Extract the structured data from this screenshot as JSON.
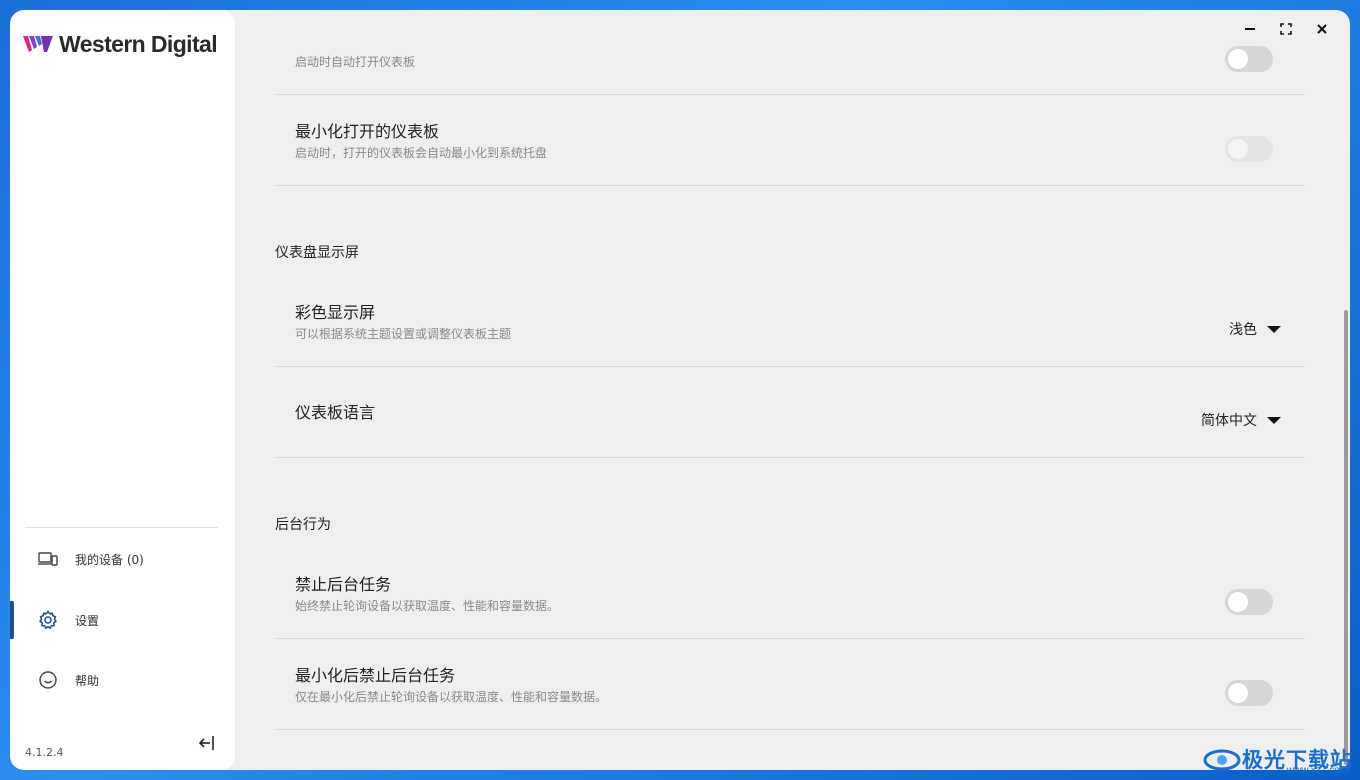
{
  "app": {
    "brand": "Western Digital",
    "version": "4.1.2.4",
    "accent": "#1f4e8c"
  },
  "window_controls": {
    "minimize": "minimize-icon",
    "maximize": "maximize-icon",
    "close": "close-icon"
  },
  "sidebar": {
    "items": [
      {
        "label": "我的设备 (0)",
        "icon": "devices-icon",
        "active": false
      },
      {
        "label": "设置",
        "icon": "gear-icon",
        "active": true
      },
      {
        "label": "帮助",
        "icon": "smile-icon",
        "active": false
      }
    ],
    "collapse_icon": "collapse-left-icon"
  },
  "settings": {
    "startup_row": {
      "subtitle": "启动时自动打开仪表板",
      "toggle_on": false
    },
    "minimize_row": {
      "title": "最小化打开的仪表板",
      "subtitle": "启动时，打开的仪表板会自动最小化到系统托盘",
      "toggle_on": false,
      "disabled": true
    },
    "display_section": "仪表盘显示屏",
    "color_row": {
      "title": "彩色显示屏",
      "subtitle": "可以根据系统主题设置或调整仪表板主题",
      "value": "浅色"
    },
    "language_row": {
      "title": "仪表板语言",
      "value": "简体中文"
    },
    "background_section": "后台行为",
    "disable_bg_row": {
      "title": "禁止后台任务",
      "subtitle": "始终禁止轮询设备以获取温度、性能和容量数据。",
      "toggle_on": false
    },
    "min_disable_bg_row": {
      "title": "最小化后禁止后台任务",
      "subtitle": "仅在最小化后禁止轮询设备以获取温度、性能和容量数据。",
      "toggle_on": false
    }
  },
  "watermark": {
    "text": "极光下载站",
    "url": "www.xz7.com"
  }
}
